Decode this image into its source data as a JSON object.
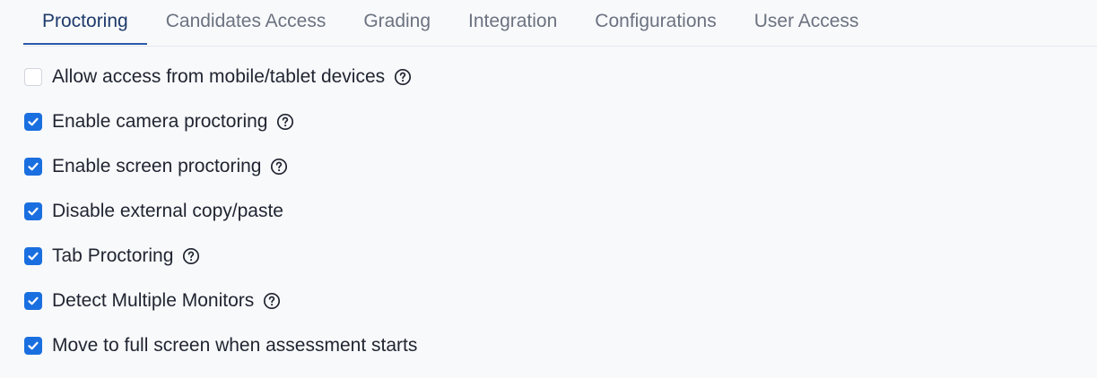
{
  "tabs": [
    {
      "label": "Proctoring",
      "active": true
    },
    {
      "label": "Candidates Access",
      "active": false
    },
    {
      "label": "Grading",
      "active": false
    },
    {
      "label": "Integration",
      "active": false
    },
    {
      "label": "Configurations",
      "active": false
    },
    {
      "label": "User Access",
      "active": false
    }
  ],
  "options": [
    {
      "label": "Allow access from mobile/tablet devices",
      "checked": false,
      "help_icon": "question-circle-icon"
    },
    {
      "label": "Enable camera proctoring",
      "checked": true,
      "help_icon": "question-circle-icon"
    },
    {
      "label": "Enable screen proctoring",
      "checked": true,
      "help_icon": "question-circle-icon"
    },
    {
      "label": "Disable external copy/paste",
      "checked": true,
      "help_icon": null
    },
    {
      "label": "Tab Proctoring",
      "checked": true,
      "help_icon": "question-circle-icon"
    },
    {
      "label": "Detect Multiple Monitors",
      "checked": true,
      "help_icon": "question-circle-icon"
    },
    {
      "label": "Move to full screen when assessment starts",
      "checked": true,
      "help_icon": null
    }
  ],
  "colors": {
    "accent": "#1a6fe0",
    "active_tab_text": "#1e3a6b",
    "active_tab_underline": "#2a5aa8",
    "inactive_tab_text": "#6b7280",
    "background": "#f8f9fb"
  }
}
